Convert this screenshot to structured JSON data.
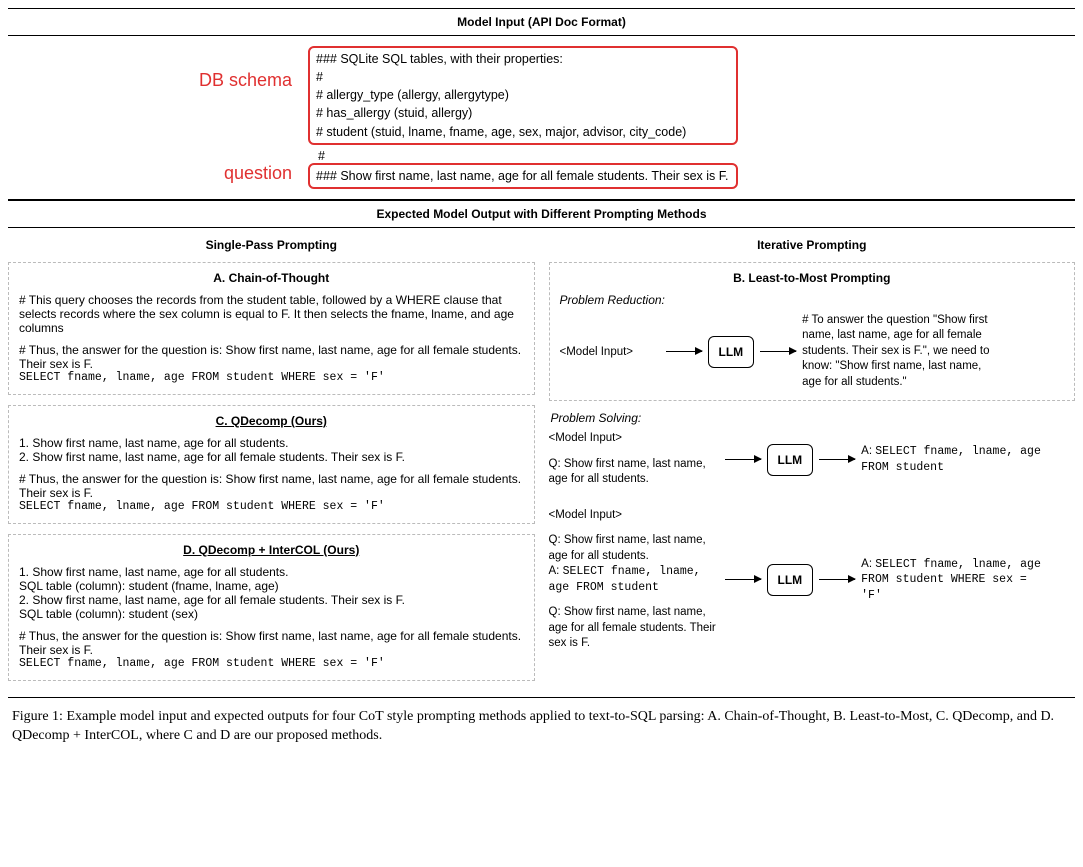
{
  "header": {
    "title": "Model Input (API Doc Format)"
  },
  "input": {
    "db_label": "DB schema",
    "q_label": "question",
    "schema_l1": "### SQLite SQL tables, with their properties:",
    "schema_l2": "#",
    "schema_l3": "# allergy_type (allergy, allergytype)",
    "schema_l4": "# has_allergy (stuid, allergy)",
    "schema_l5": "# student (stuid, lname, fname, age, sex, major, advisor, city_code)",
    "hash": "#",
    "question": "### Show first name, last name, age for all female students. Their sex is F."
  },
  "expected_title": "Expected Model Output with Different Prompting Methods",
  "left_title": "Single-Pass Prompting",
  "right_title": "Iterative Prompting",
  "boxA": {
    "title": "A. Chain-of-Thought",
    "p1": "# This query chooses the records from the student table, followed by a WHERE clause that selects records where the sex column is equal to F. It then selects the fname, lname, and age columns",
    "p2": "# Thus, the answer for the question is: Show first name, last name, age for all female students. Their sex is F.",
    "sql": "SELECT fname, lname, age FROM student WHERE sex = 'F'"
  },
  "boxC": {
    "title": "C. QDecomp (Ours)",
    "l1": "1. Show first name, last name, age for all students.",
    "l2": "2. Show first name, last name, age for all female students. Their sex is F.",
    "p2": "# Thus, the answer for the question is: Show first name, last name, age for all female students. Their sex is F.",
    "sql": "SELECT fname, lname, age FROM student WHERE sex = 'F'"
  },
  "boxD": {
    "title": "D. QDecomp + InterCOL (Ours)",
    "l1": "1. Show first name, last name, age for all students.",
    "l1b": "SQL table (column): student (fname, lname, age)",
    "l2": "2. Show first name, last name, age for all female students. Their sex is F.",
    "l2b": "SQL table (column): student (sex)",
    "p2": "# Thus, the answer for the question is: Show first name, last name, age for all female students. Their sex is F.",
    "sql": "SELECT fname, lname, age FROM student WHERE sex = 'F'"
  },
  "boxB": {
    "title": "B. Least-to-Most Prompting",
    "reduction_label": "Problem Reduction:",
    "solving_label": "Problem Solving:",
    "model_input": "<Model Input>",
    "llm": "LLM",
    "reduction_out": "# To answer the question \"Show first name, last name, age for all female students. Their sex is F.\", we need to know: \"Show first name, last name, age for all students.\"",
    "s1_left_l2": "Q: Show first name, last name, age for all students.",
    "s1_out_prefix": "A: ",
    "s1_out_sql": "SELECT fname, lname, age FROM student",
    "s2_left_l2": "Q: Show first name, last name, age for all students.",
    "s2_left_l3a": "A: ",
    "s2_left_l3b": "SELECT fname, lname, age FROM student",
    "s2_left_l4": "Q: Show first name, last name, age for all female students. Their sex is F.",
    "s2_out_prefix": "A: ",
    "s2_out_sql": "SELECT fname, lname, age FROM student WHERE sex = 'F'"
  },
  "caption": "Figure 1: Example model input and expected outputs for four CoT style prompting methods applied to text-to-SQL parsing: A. Chain-of-Thought, B. Least-to-Most, C. QDecomp, and D. QDecomp + InterCOL, where C and D are our proposed methods."
}
